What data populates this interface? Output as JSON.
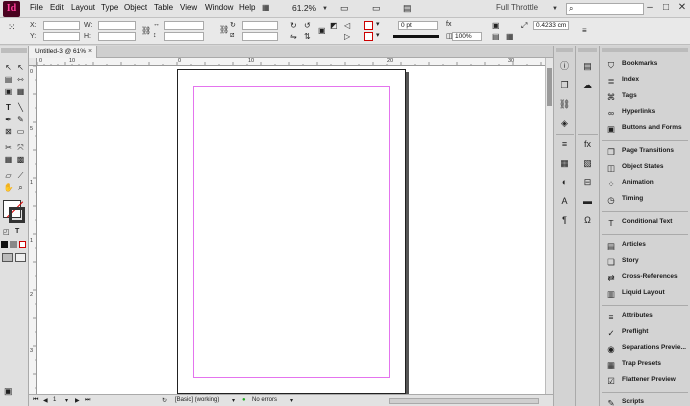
{
  "app": {
    "logo": "Id",
    "zoom": "61.2%",
    "workspace": "Full Throttle"
  },
  "menu": [
    "File",
    "Edit",
    "Layout",
    "Type",
    "Object",
    "Table",
    "View",
    "Window",
    "Help"
  ],
  "window_controls": {
    "minimize": "–",
    "maximize": "□",
    "close": "✕"
  },
  "control": {
    "x_label": "X:",
    "y_label": "Y:",
    "w_label": "W:",
    "h_label": "H:",
    "stroke_weight": "0 pt",
    "opacity": "100%",
    "offset": "0.4233 cm"
  },
  "document": {
    "tab_title": "Untitled-3 @ 61%",
    "close": "×"
  },
  "ruler": {
    "h_labels": [
      "0",
      "10",
      "0",
      "10",
      "20",
      "30"
    ],
    "v_labels": [
      "0",
      "5",
      "1",
      "1",
      "2",
      "3"
    ]
  },
  "status": {
    "page": "1",
    "master": "[Basic] (working)",
    "preflight": "No errors"
  },
  "tools": [
    "selection-tool",
    "direct-selection-tool",
    "page-tool",
    "gap-tool",
    "content-collector-tool",
    "content-placer-tool",
    "type-tool",
    "line-tool",
    "pen-tool",
    "pencil-tool",
    "rectangle-frame-tool",
    "rectangle-tool",
    "scissors-tool",
    "free-transform-tool",
    "gradient-swatch-tool",
    "gradient-feather-tool",
    "note-tool",
    "eyedropper-tool",
    "hand-tool",
    "zoom-tool"
  ],
  "panels_list": [
    {
      "label": "Bookmarks",
      "icon": "bookmark-icon",
      "glyph": "⛉"
    },
    {
      "label": "Index",
      "icon": "index-icon",
      "glyph": "≣"
    },
    {
      "label": "Tags",
      "icon": "tag-icon",
      "glyph": "⌘"
    },
    {
      "label": "Hyperlinks",
      "icon": "hyperlink-icon",
      "glyph": "∞"
    },
    {
      "label": "Buttons and Forms",
      "icon": "button-icon",
      "glyph": "▣"
    },
    {
      "label": "Page Transitions",
      "icon": "page-transitions-icon",
      "glyph": "❐"
    },
    {
      "label": "Object States",
      "icon": "object-states-icon",
      "glyph": "◫"
    },
    {
      "label": "Animation",
      "icon": "animation-icon",
      "glyph": "⁘"
    },
    {
      "label": "Timing",
      "icon": "timing-icon",
      "glyph": "◷"
    },
    {
      "label": "Conditional Text",
      "icon": "conditional-text-icon",
      "glyph": "T"
    },
    {
      "label": "Articles",
      "icon": "articles-icon",
      "glyph": "▤"
    },
    {
      "label": "Story",
      "icon": "story-icon",
      "glyph": "❏"
    },
    {
      "label": "Cross-References",
      "icon": "cross-references-icon",
      "glyph": "⇄"
    },
    {
      "label": "Liquid Layout",
      "icon": "liquid-layout-icon",
      "glyph": "▥"
    },
    {
      "label": "Attributes",
      "icon": "attributes-icon",
      "glyph": "≡"
    },
    {
      "label": "Preflight",
      "icon": "preflight-icon",
      "glyph": "✓"
    },
    {
      "label": "Separations Previe...",
      "icon": "separations-icon",
      "glyph": "◉"
    },
    {
      "label": "Trap Presets",
      "icon": "trap-presets-icon",
      "glyph": "▦"
    },
    {
      "label": "Flattener Preview",
      "icon": "flattener-icon",
      "glyph": "☑"
    },
    {
      "label": "Scripts",
      "icon": "scripts-icon",
      "glyph": "✎"
    }
  ],
  "strip1": [
    {
      "icon": "info-icon",
      "glyph": "ⓘ"
    },
    {
      "icon": "pages-icon",
      "glyph": "❐"
    },
    {
      "icon": "links-icon",
      "glyph": "⛓"
    },
    {
      "icon": "layers-icon",
      "glyph": "◈"
    },
    {
      "icon": "stroke-icon",
      "glyph": "≡"
    },
    {
      "icon": "swatches-icon",
      "glyph": "▦"
    },
    {
      "icon": "color-icon",
      "glyph": "◐"
    },
    {
      "icon": "character-styles-icon",
      "glyph": "A"
    },
    {
      "icon": "paragraph-styles-icon",
      "glyph": "¶"
    }
  ],
  "strip2": [
    {
      "icon": "properties-icon",
      "glyph": "▤"
    },
    {
      "icon": "cc-libraries-icon",
      "glyph": "☁"
    },
    {
      "icon": "effects-icon",
      "glyph": "fx"
    },
    {
      "icon": "text-wrap-icon",
      "glyph": "▧"
    },
    {
      "icon": "align-icon",
      "glyph": "⊟"
    },
    {
      "icon": "gradient-icon",
      "glyph": "▬"
    },
    {
      "icon": "glyphs-icon",
      "glyph": "Ω"
    }
  ]
}
